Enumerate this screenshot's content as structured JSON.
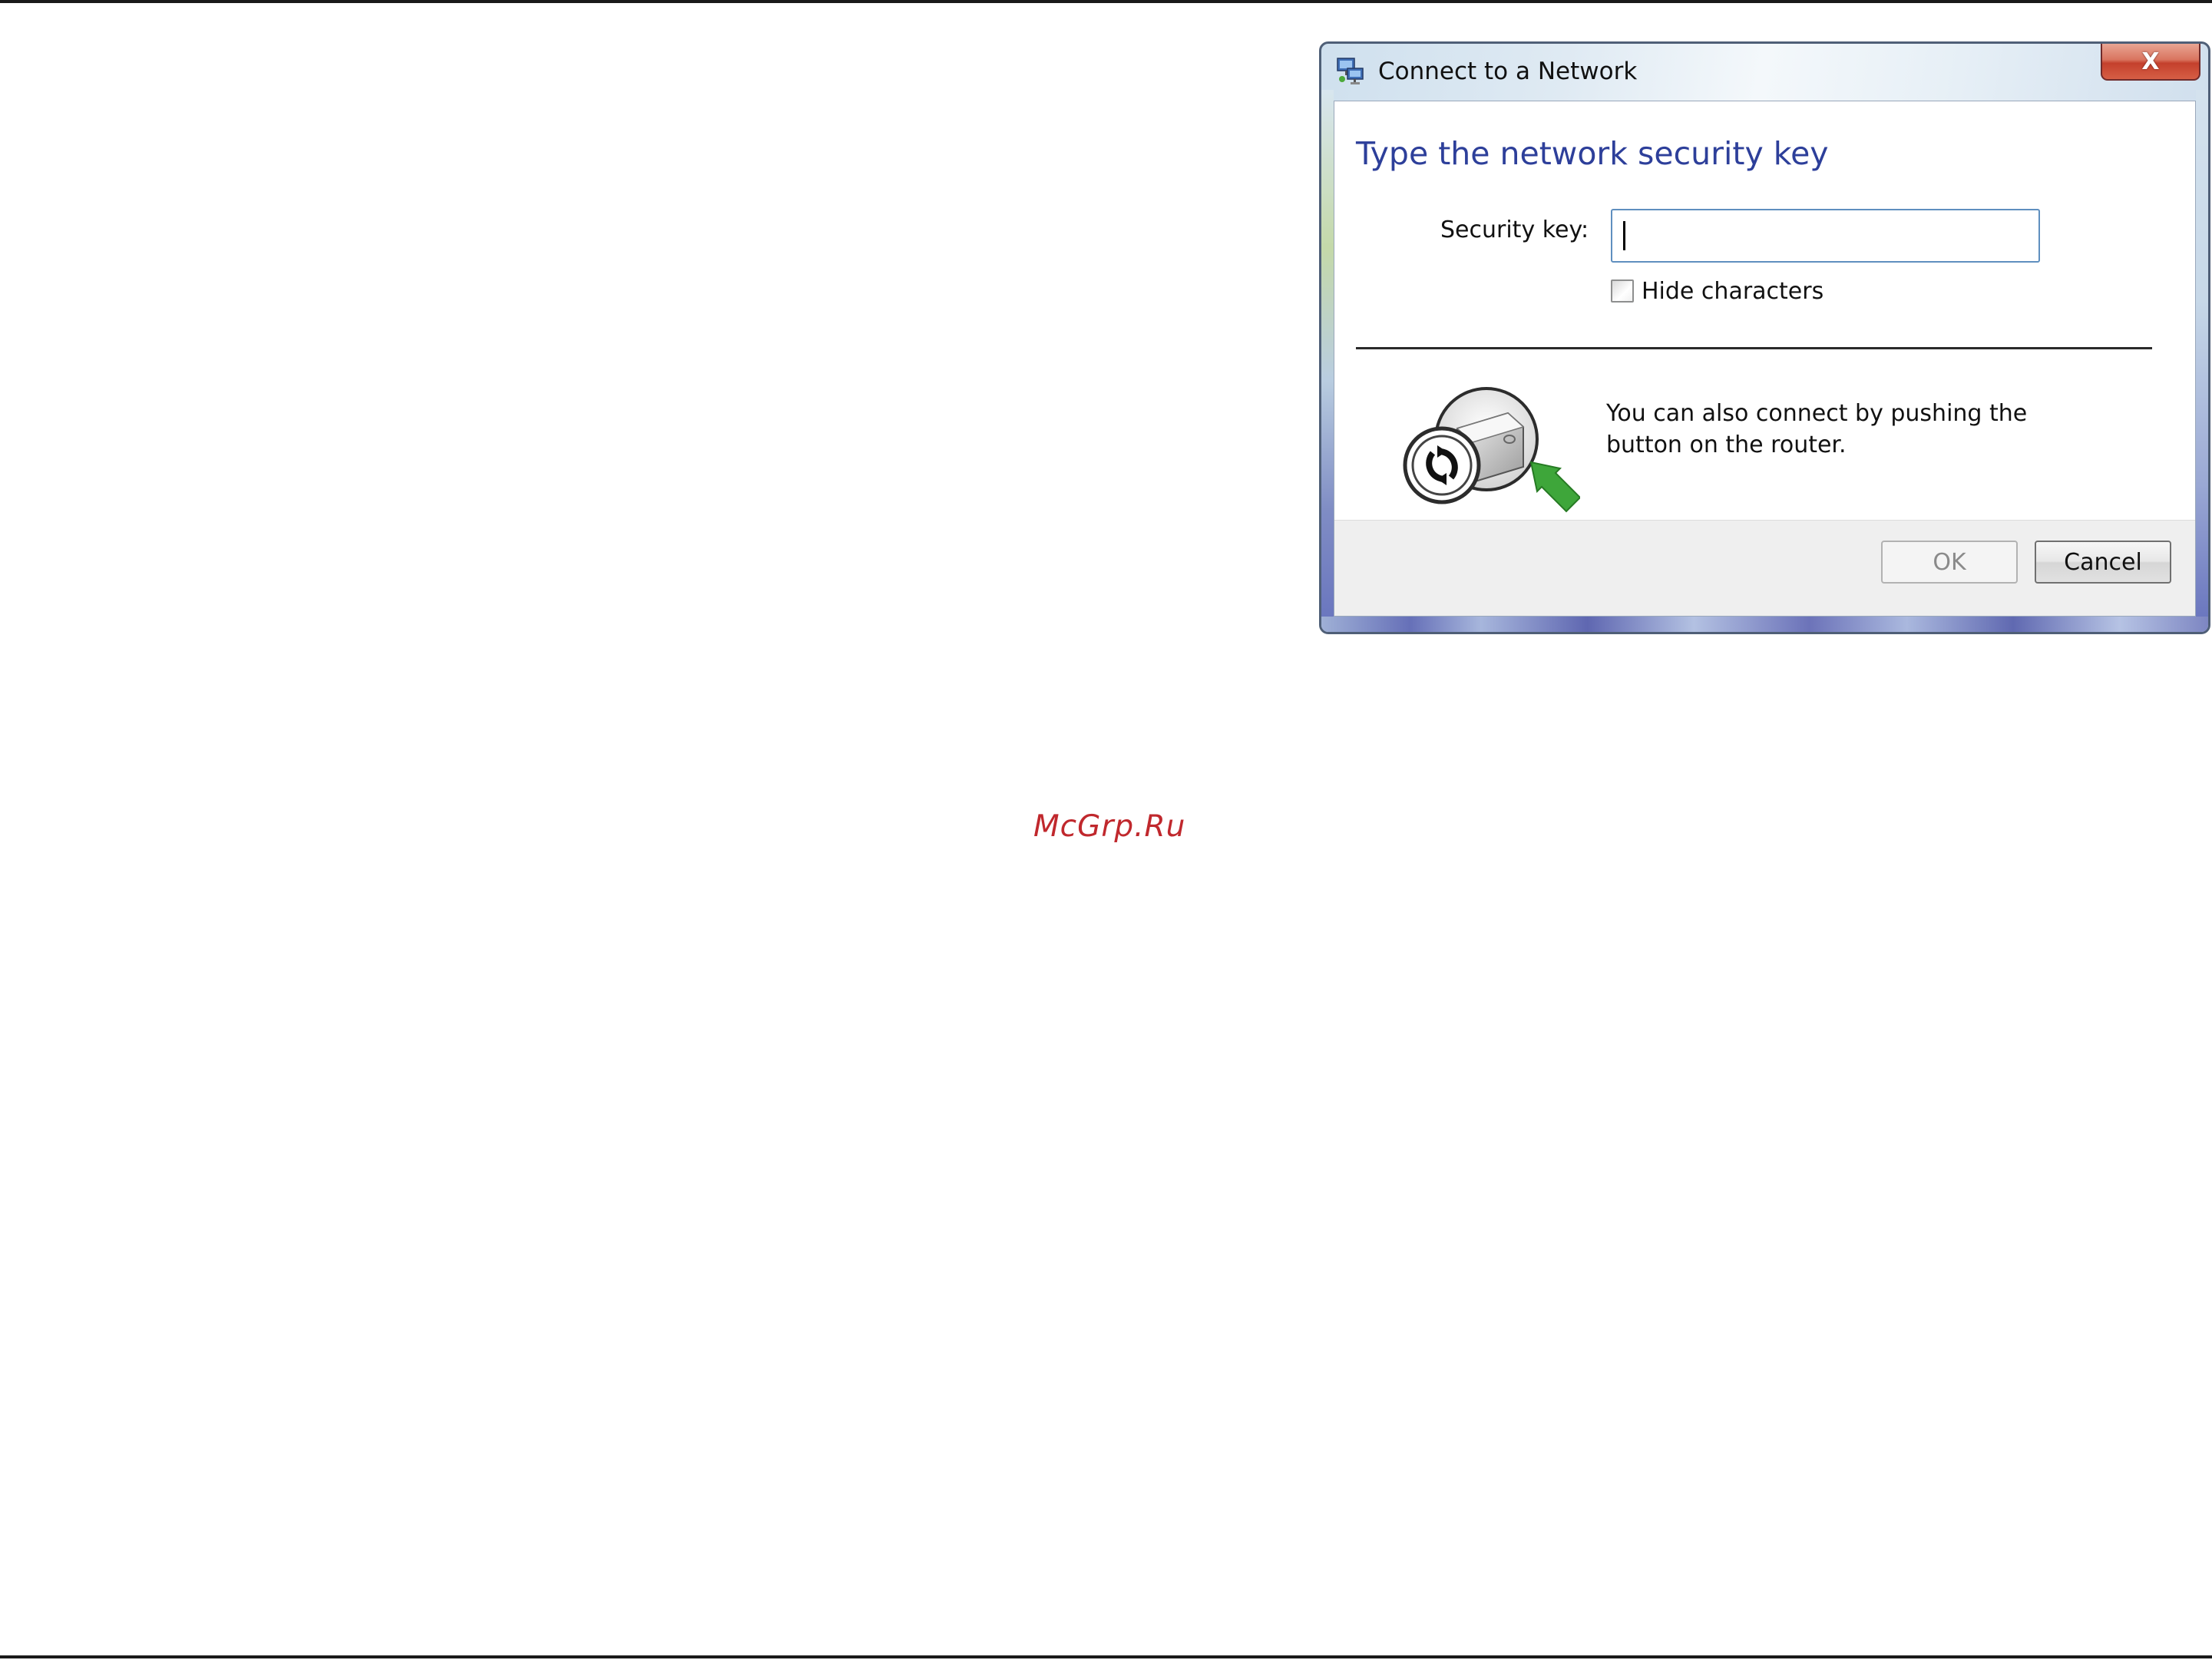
{
  "watermark": "McGrp.Ru",
  "dialog": {
    "title": "Connect to a Network",
    "close_label": "X",
    "heading": "Type the network security key",
    "security_key": {
      "label": "Security key:",
      "value": "",
      "placeholder": ""
    },
    "hide_characters": {
      "label": "Hide characters",
      "checked": false
    },
    "wps_text": "You can also connect by pushing the button on the router.",
    "buttons": {
      "ok": "OK",
      "cancel": "Cancel"
    },
    "icons": {
      "title": "network-icon",
      "wps": "wps-router-push-icon"
    }
  }
}
